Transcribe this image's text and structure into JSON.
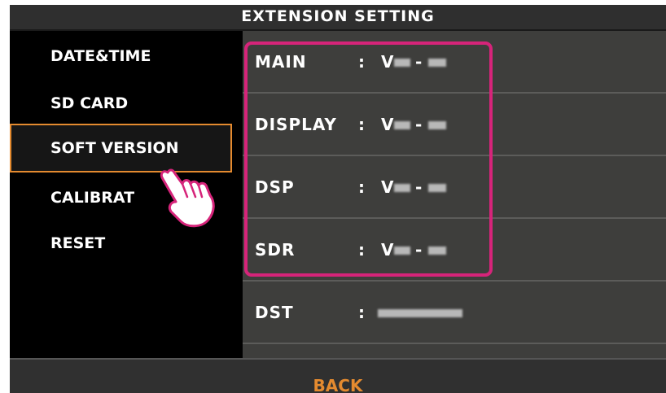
{
  "header": {
    "title": "EXTENSION SETTING"
  },
  "menu": {
    "items": [
      {
        "label": "DATE&TIME"
      },
      {
        "label": "SD CARD"
      },
      {
        "label": "SOFT VERSION"
      },
      {
        "label": "CALIBRAT"
      },
      {
        "label": "RESET"
      }
    ],
    "selected_index": 2
  },
  "versions": [
    {
      "name": "MAIN",
      "sep": ":",
      "prefix": "V",
      "dash": "-"
    },
    {
      "name": "DISPLAY",
      "sep": ":",
      "prefix": "V",
      "dash": "-"
    },
    {
      "name": "DSP",
      "sep": ":",
      "prefix": "V",
      "dash": "-"
    },
    {
      "name": "SDR",
      "sep": ":",
      "prefix": "V",
      "dash": "-"
    },
    {
      "name": "DST",
      "sep": ":"
    }
  ],
  "footer": {
    "back_label": "BACK"
  },
  "colors": {
    "accent": "#e48a2f",
    "highlight": "#d6247a",
    "panel": "#3e3e3c",
    "background": "#000000"
  },
  "icons": {
    "pointer": "hand-pointer-icon"
  }
}
